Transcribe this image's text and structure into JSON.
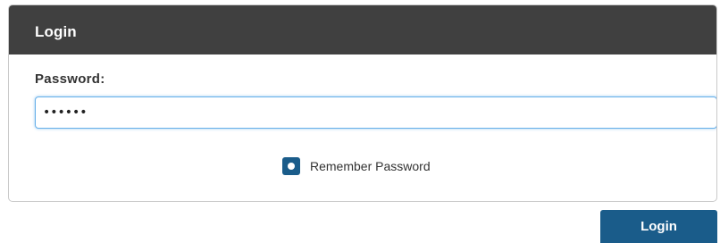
{
  "panel": {
    "title": "Login"
  },
  "password": {
    "label": "Password:",
    "value": "••••••"
  },
  "remember": {
    "label": "Remember Password",
    "checked": true
  },
  "actions": {
    "login_label": "Login"
  },
  "colors": {
    "header_bg": "#404040",
    "accent": "#1a5c8a",
    "focus_border": "#66afe9"
  }
}
